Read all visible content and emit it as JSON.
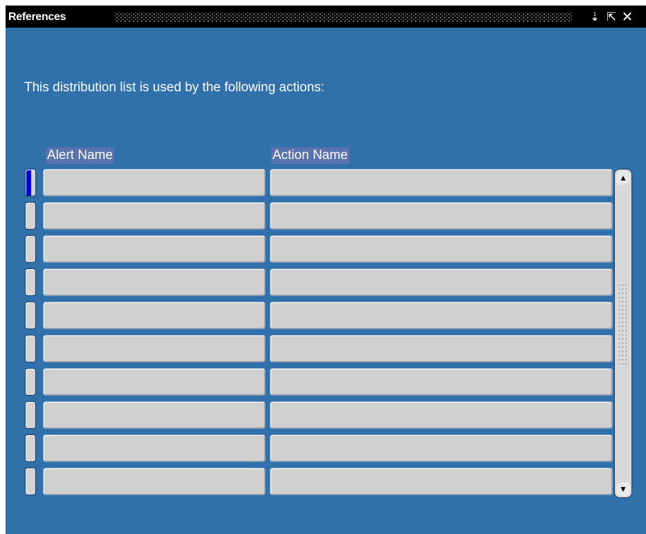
{
  "window": {
    "title": "References",
    "minimize_glyph": "⇣",
    "maximize_glyph": "⇱",
    "close_glyph": "✕"
  },
  "prompt": "This distribution list is used by the following actions:",
  "table": {
    "columns": [
      "Alert Name",
      "Action Name"
    ],
    "rows": [
      {
        "alert_name": "",
        "action_name": ""
      },
      {
        "alert_name": "",
        "action_name": ""
      },
      {
        "alert_name": "",
        "action_name": ""
      },
      {
        "alert_name": "",
        "action_name": ""
      },
      {
        "alert_name": "",
        "action_name": ""
      },
      {
        "alert_name": "",
        "action_name": ""
      },
      {
        "alert_name": "",
        "action_name": ""
      },
      {
        "alert_name": "",
        "action_name": ""
      },
      {
        "alert_name": "",
        "action_name": ""
      },
      {
        "alert_name": "",
        "action_name": ""
      }
    ],
    "current_row": 0
  },
  "scrollbar": {
    "up_glyph": "▲",
    "down_glyph": "▼"
  },
  "colors": {
    "background": "#3071ab",
    "titlebar": "#000000",
    "cell": "#d0d0d0",
    "row_indicator_current": "#0000d8"
  },
  "icons": {
    "minimize": "minimize-icon",
    "maximize": "maximize-icon",
    "close": "close-icon",
    "scroll_up": "arrow-up-icon",
    "scroll_down": "arrow-down-icon"
  }
}
